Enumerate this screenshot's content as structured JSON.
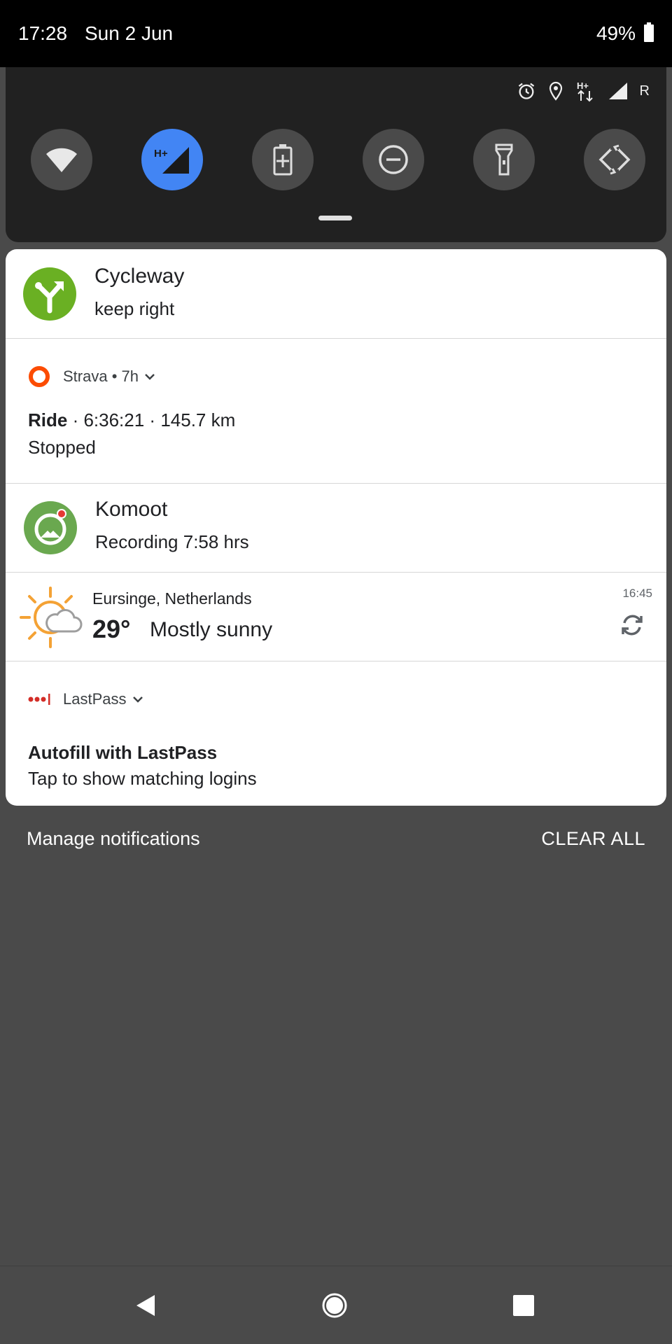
{
  "status_bar": {
    "time": "17:28",
    "date": "Sun 2 Jun",
    "battery": "49%"
  },
  "quick_settings": {
    "status_icons": [
      "alarm-icon",
      "location-icon",
      "hplus-data-icon",
      "signal-icon"
    ],
    "roaming": "R",
    "tiles": [
      {
        "name": "wifi-icon",
        "active": false
      },
      {
        "name": "mobile-data-icon",
        "label": "H+",
        "active": true
      },
      {
        "name": "battery-saver-icon",
        "active": false
      },
      {
        "name": "do-not-disturb-icon",
        "active": false
      },
      {
        "name": "flashlight-icon",
        "active": false
      },
      {
        "name": "auto-rotate-icon",
        "active": false
      }
    ],
    "accent_color": "#4285f4"
  },
  "notifications": {
    "cycleway": {
      "title": "Cycleway",
      "subtitle": "keep right",
      "icon_color": "#6ab023"
    },
    "strava": {
      "app_name": "Strava",
      "time_ago": "7h",
      "activity": "Ride",
      "duration": "6:36:21",
      "distance": "145.7 km",
      "status": "Stopped",
      "icon_color": "#fc4c02"
    },
    "komoot": {
      "title": "Komoot",
      "subtitle": "Recording 7:58 hrs",
      "icon_color": "#6aa84f"
    },
    "weather": {
      "location": "Eursinge, Netherlands",
      "temperature": "29°",
      "condition": "Mostly sunny",
      "updated": "16:45"
    },
    "lastpass": {
      "app_name": "LastPass",
      "title": "Autofill with LastPass",
      "subtitle": "Tap to show matching logins",
      "icon_color": "#d32d27"
    }
  },
  "footer": {
    "manage_label": "Manage notifications",
    "clear_label": "CLEAR ALL"
  },
  "nav_bar": {
    "buttons": [
      "back-icon",
      "home-icon",
      "recents-icon"
    ]
  }
}
